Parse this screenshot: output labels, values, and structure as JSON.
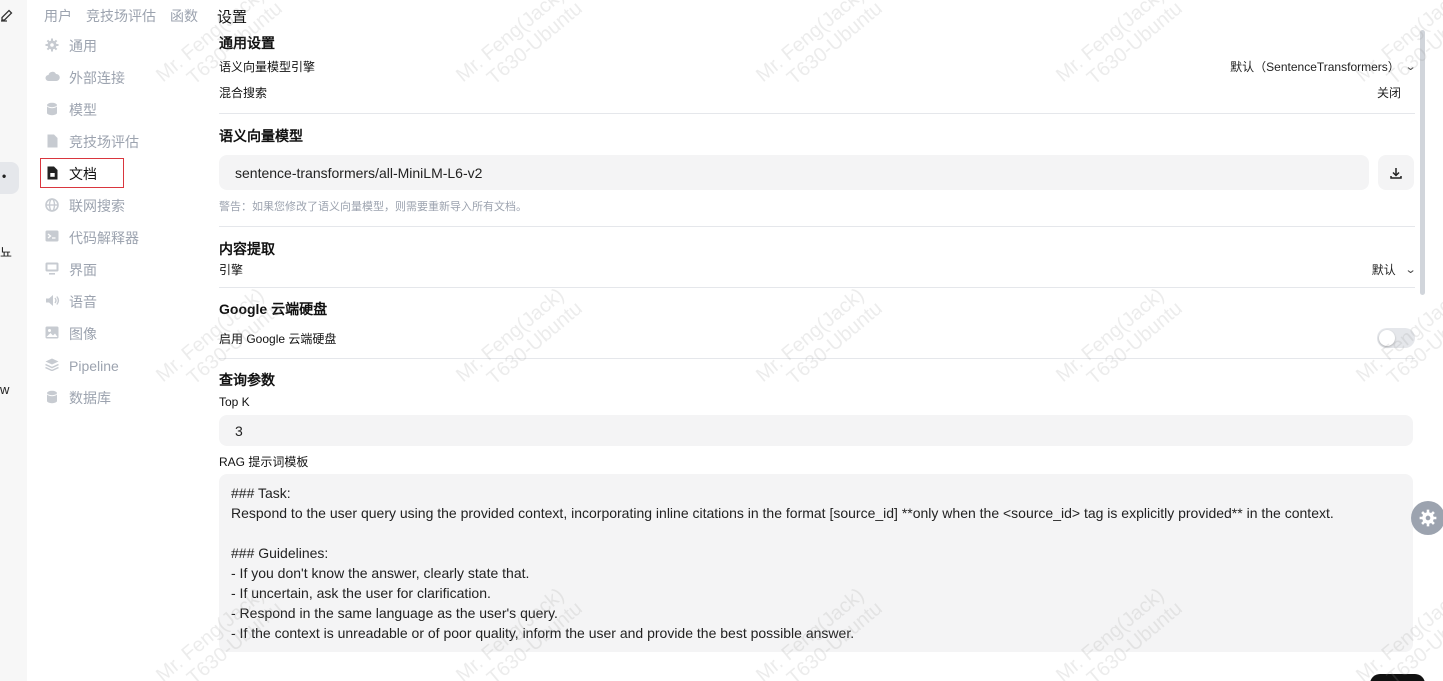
{
  "top_tabs": [
    "用户",
    "竞技场评估",
    "函数"
  ],
  "page_title": "设置",
  "nav": {
    "items": [
      {
        "label": "通用",
        "icon": "gear-icon"
      },
      {
        "label": "外部连接",
        "icon": "cloud-icon"
      },
      {
        "label": "模型",
        "icon": "database-icon"
      },
      {
        "label": "竞技场评估",
        "icon": "document-icon"
      },
      {
        "label": "文档",
        "icon": "document-lock-icon"
      },
      {
        "label": "联网搜索",
        "icon": "globe-icon"
      },
      {
        "label": "代码解释器",
        "icon": "terminal-icon"
      },
      {
        "label": "界面",
        "icon": "monitor-icon"
      },
      {
        "label": "语音",
        "icon": "speaker-icon"
      },
      {
        "label": "图像",
        "icon": "image-icon"
      },
      {
        "label": "Pipeline",
        "icon": "layers-icon"
      },
      {
        "label": "数据库",
        "icon": "database-icon"
      }
    ],
    "active_index": 4
  },
  "left_strip": {
    "char1": "뇨",
    "char2": "w"
  },
  "general": {
    "heading": "通用设置",
    "embedding_engine_label": "语义向量模型引擎",
    "embedding_engine_value": "默认（SentenceTransformers）",
    "hybrid_search_label": "混合搜索",
    "hybrid_search_value": "关闭"
  },
  "embedding_model": {
    "heading": "语义向量模型",
    "value": "sentence-transformers/all-MiniLM-L6-v2",
    "warning": "警告：如果您修改了语义向量模型，则需要重新导入所有文档。"
  },
  "content_extraction": {
    "heading": "内容提取",
    "engine_label": "引擎",
    "engine_value": "默认"
  },
  "google_drive": {
    "heading": "Google 云端硬盘",
    "enable_label": "启用 Google 云端硬盘",
    "enabled": false
  },
  "query_params": {
    "heading": "查询参数",
    "topk_label": "Top K",
    "topk_value": "3",
    "rag_label": "RAG 提示词模板",
    "rag_template": "### Task:\nRespond to the user query using the provided context, incorporating inline citations in the format [source_id] **only when the <source_id> tag is explicitly provided** in the context.\n\n### Guidelines:\n- If you don't know the answer, clearly state that.\n- If uncertain, ask the user for clarification.\n- Respond in the same language as the user's query.\n- If the context is unreadable or of poor quality, inform the user and provide the best possible answer."
  },
  "watermark": {
    "line1": "Mr. Feng(Jack)",
    "line2": "T630-Ubuntu"
  }
}
